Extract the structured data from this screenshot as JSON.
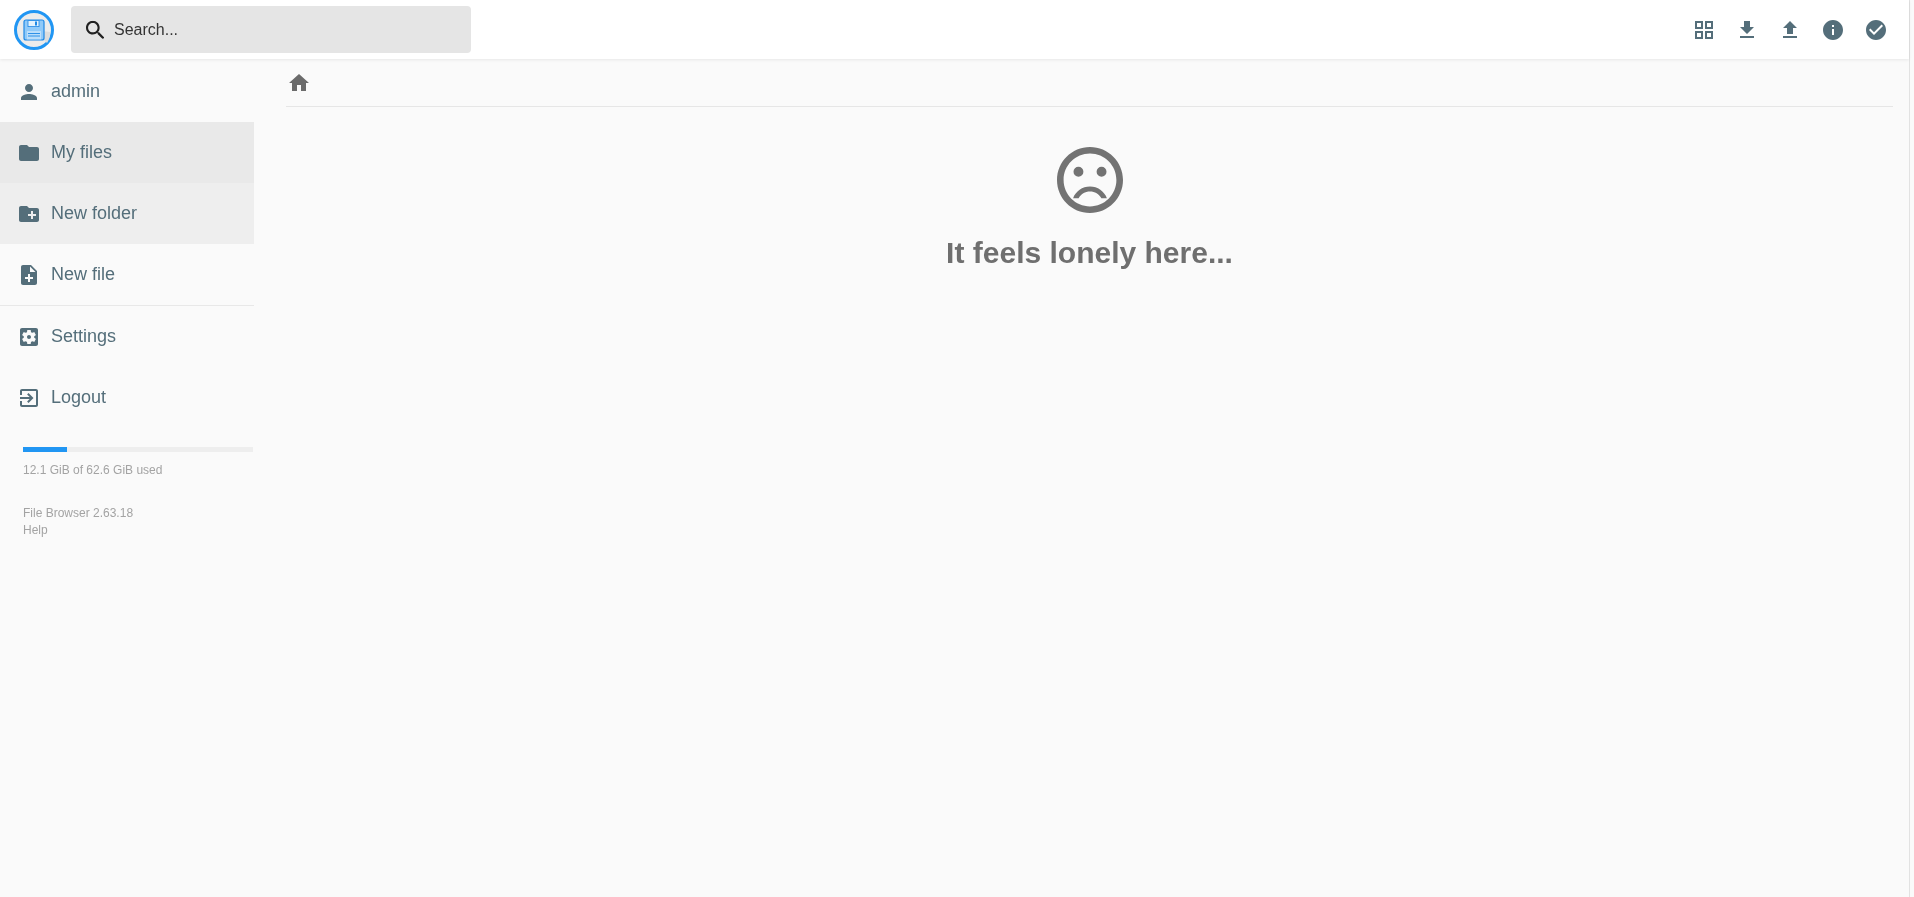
{
  "search": {
    "placeholder": "Search..."
  },
  "sidebar": {
    "sections": [
      {
        "items": [
          {
            "kind": "user",
            "label": "admin",
            "selected": false,
            "hovered": false
          },
          {
            "kind": "files",
            "label": "My files",
            "selected": true,
            "hovered": false
          },
          {
            "kind": "newfolder",
            "label": "New folder",
            "selected": false,
            "hovered": true
          },
          {
            "kind": "newfile",
            "label": "New file",
            "selected": false,
            "hovered": false
          }
        ]
      },
      {
        "items": [
          {
            "kind": "settings",
            "label": "Settings",
            "selected": false,
            "hovered": false
          },
          {
            "kind": "logout",
            "label": "Logout",
            "selected": false,
            "hovered": false
          }
        ]
      }
    ],
    "storage": {
      "level": 0.19,
      "reading": "12.1 GiB of 62.6 GiB used"
    },
    "footer": {
      "version": "File Browser 2.63.18",
      "help": "Help"
    }
  },
  "main": {
    "empty_message": "It feels lonely here..."
  }
}
